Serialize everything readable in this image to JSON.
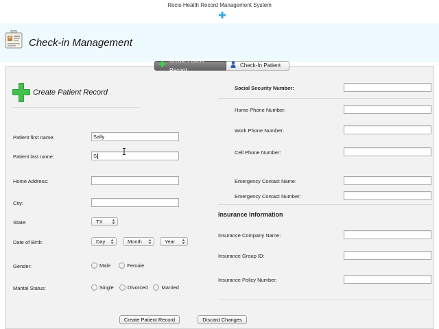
{
  "app": {
    "title": "Recio Health Record Management System"
  },
  "header": {
    "title": "Check-in Management"
  },
  "tabs": [
    {
      "label": "Create Patient Record",
      "active": true
    },
    {
      "label": "Check-In Patient",
      "active": false
    }
  ],
  "section": {
    "title": "Create Patient Record"
  },
  "left_form": {
    "first_name": {
      "label": "Patient first name:",
      "value": "Sally"
    },
    "last_name": {
      "label": "Patient last name:",
      "value": "S"
    },
    "home_address": {
      "label": "Home Address:",
      "value": ""
    },
    "city": {
      "label": "City:",
      "value": ""
    },
    "state": {
      "label": "State:",
      "value": "TX"
    },
    "dob": {
      "label": "Date of Birth:",
      "day": "Day",
      "month": "Month",
      "year": "Year"
    },
    "gender": {
      "label": "Gender:",
      "options": [
        "Male",
        "Female"
      ]
    },
    "marital": {
      "label": "Marital Status:",
      "options": [
        "Single",
        "Divorced",
        "Married"
      ]
    }
  },
  "right_form": {
    "ssn": {
      "label": "Social Security Number:",
      "value": ""
    },
    "home_phone": {
      "label": "Home Phone Number:",
      "value": ""
    },
    "work_phone": {
      "label": "Work Phone Number:",
      "value": ""
    },
    "cell_phone": {
      "label": "Cell Phone Number:",
      "value": ""
    },
    "emergency_name": {
      "label": "Emergency Contact Name:",
      "value": ""
    },
    "emergency_number": {
      "label": "Emergency Contact Number:",
      "value": ""
    }
  },
  "insurance": {
    "title": "Insurance Information",
    "company": {
      "label": "Insurance Company Name:",
      "value": ""
    },
    "group_id": {
      "label": "Insurance Group ID:",
      "value": ""
    },
    "policy": {
      "label": "Insurance Policy Number:",
      "value": ""
    }
  },
  "buttons": {
    "create": "Create Patient Record",
    "discard": "Discard Changes"
  },
  "colors": {
    "header_bg": "#eefafd",
    "content_bg": "#f2f2f2",
    "accent": "#2b9f3a",
    "plus": "#3aa8e0"
  },
  "icons": {
    "app": "plus-icon",
    "header": "id-card-icon",
    "section": "green-plus-icon",
    "tab_create": "green-plus-icon",
    "tab_checkin": "person-icon"
  }
}
